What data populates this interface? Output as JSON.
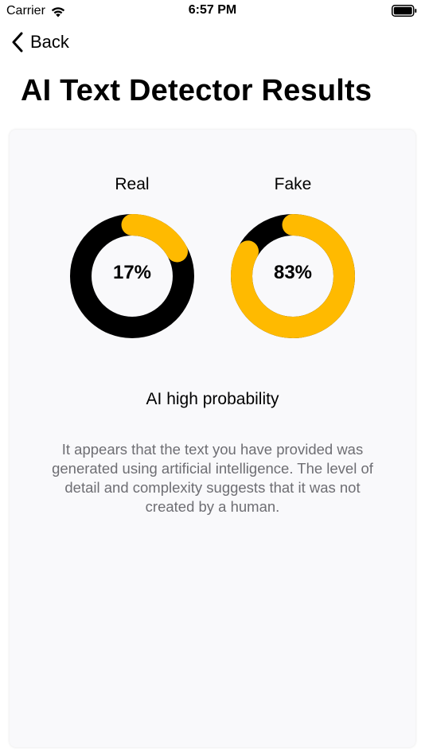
{
  "status_bar": {
    "carrier": "Carrier",
    "time": "6:57 PM"
  },
  "nav": {
    "back_label": "Back"
  },
  "page": {
    "title": "AI Text Detector Results"
  },
  "results": {
    "real": {
      "label": "Real",
      "value_text": "17%",
      "percent": 17
    },
    "fake": {
      "label": "Fake",
      "value_text": "83%",
      "percent": 83
    },
    "heading": "AI high probability",
    "description": "It appears that the text you have provided was generated using artificial intelligence. The level of detail and complexity suggests that it was not created by a human."
  },
  "colors": {
    "accent": "#FFBA00",
    "track": "#000000",
    "card_bg": "#F9F9FB",
    "secondary_text": "#6E6E73"
  },
  "icons": {
    "wifi": "wifi-icon",
    "battery": "battery-icon",
    "back": "chevron-left-icon"
  }
}
